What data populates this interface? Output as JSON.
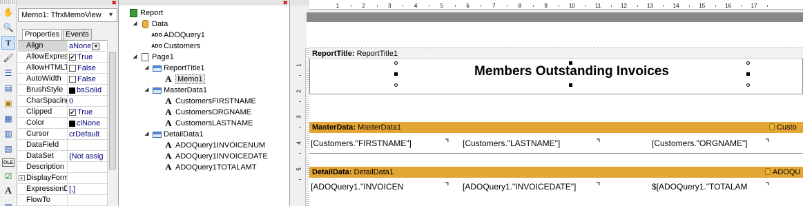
{
  "toolbar": {
    "tools": [
      {
        "icon": "hand-icon",
        "glyph": "✋"
      },
      {
        "icon": "zoom-icon",
        "glyph": "🔍"
      },
      {
        "icon": "text-tool-icon",
        "glyph": "T"
      },
      {
        "icon": "brush-icon",
        "glyph": "🖌"
      },
      {
        "icon": "band-icon",
        "glyph": "☰"
      },
      {
        "icon": "memo-icon",
        "glyph": "▤"
      },
      {
        "icon": "picture-icon",
        "glyph": "▣"
      },
      {
        "icon": "subreport-icon",
        "glyph": "▦"
      },
      {
        "icon": "chart-icon",
        "glyph": "▥"
      },
      {
        "icon": "richtext-icon",
        "glyph": "▧"
      },
      {
        "icon": "ole-icon",
        "glyph": "OLE"
      },
      {
        "icon": "checkbox-icon",
        "glyph": "☑"
      },
      {
        "icon": "text-icon",
        "glyph": "A"
      },
      {
        "icon": "more-icon",
        "glyph": "▨"
      }
    ]
  },
  "inspector": {
    "selected_object": "Memo1: TfrxMemoView",
    "tabs": [
      {
        "label": "Properties"
      },
      {
        "label": "Events"
      }
    ],
    "properties": [
      {
        "name": "Align",
        "value": "aNone",
        "kind": "dropdown"
      },
      {
        "name": "AllowExpress",
        "value": "True",
        "kind": "checked"
      },
      {
        "name": "AllowHTMLTa",
        "value": "False",
        "kind": "unchecked"
      },
      {
        "name": "AutoWidth",
        "value": "False",
        "kind": "unchecked"
      },
      {
        "name": "BrushStyle",
        "value": "bsSolid",
        "kind": "swatch"
      },
      {
        "name": "CharSpacing",
        "value": "0",
        "kind": "text"
      },
      {
        "name": "Clipped",
        "value": "True",
        "kind": "checked"
      },
      {
        "name": "Color",
        "value": "clNone",
        "kind": "swatch"
      },
      {
        "name": "Cursor",
        "value": "crDefault",
        "kind": "text"
      },
      {
        "name": "DataField",
        "value": "",
        "kind": "text"
      },
      {
        "name": "DataSet",
        "value": "(Not assig",
        "kind": "text"
      },
      {
        "name": "Description",
        "value": "",
        "kind": "text"
      },
      {
        "name": "DisplayForma",
        "value": "",
        "kind": "expand"
      },
      {
        "name": "ExpressionDe",
        "value": "[,]",
        "kind": "text"
      },
      {
        "name": "FlowTo",
        "value": "",
        "kind": "text"
      }
    ]
  },
  "tree": {
    "nodes": [
      {
        "label": "Report",
        "icon": "report-icon"
      },
      {
        "label": "Data",
        "icon": "database-icon"
      },
      {
        "label": "ADOQuery1",
        "icon": "ado-icon"
      },
      {
        "label": "Customers",
        "icon": "ado-icon"
      },
      {
        "label": "Page1",
        "icon": "page-icon"
      },
      {
        "label": "ReportTitle1",
        "icon": "band-icon"
      },
      {
        "label": "Memo1",
        "icon": "text-icon"
      },
      {
        "label": "MasterData1",
        "icon": "band-icon"
      },
      {
        "label": "CustomersFIRSTNAME",
        "icon": "text-icon"
      },
      {
        "label": "CustomersORGNAME",
        "icon": "text-icon"
      },
      {
        "label": "CustomersLASTNAME",
        "icon": "text-icon"
      },
      {
        "label": "DetailData1",
        "icon": "band-icon"
      },
      {
        "label": "ADOQuery1INVOICENUM",
        "icon": "text-icon"
      },
      {
        "label": "ADOQuery1INVOICEDATE",
        "icon": "text-icon"
      },
      {
        "label": "ADOQuery1TOTALAMT",
        "icon": "text-icon"
      }
    ]
  },
  "ruler": {
    "ticks": [
      "1",
      "2",
      "3",
      "4",
      "5",
      "6",
      "7",
      "8",
      "9",
      "10",
      "11",
      "12",
      "13",
      "14",
      "15",
      "16",
      "17"
    ],
    "vticks": [
      "1",
      "2",
      "3",
      "4",
      "5"
    ]
  },
  "designer": {
    "report_title": {
      "label": "ReportTitle:",
      "name": "ReportTitle1",
      "memo_text": "Members Outstanding Invoices"
    },
    "master": {
      "label": "MasterData:",
      "name": "MasterData1",
      "dataset": "Custo",
      "fields": [
        "[Customers.\"FIRSTNAME\"]",
        "[Customers.\"LASTNAME\"]",
        "[Customers.\"ORGNAME\"]"
      ]
    },
    "detail": {
      "label": "DetailData:",
      "name": "DetailData1",
      "dataset": "ADOQU",
      "fields": [
        "[ADOQuery1.\"INVOICEN",
        "[ADOQuery1.\"INVOICEDATE\"]",
        "$[ADOQuery1.\"TOTALAM"
      ]
    },
    "colors": {
      "band_header": "#e3a534",
      "page_band": "#888888"
    }
  }
}
